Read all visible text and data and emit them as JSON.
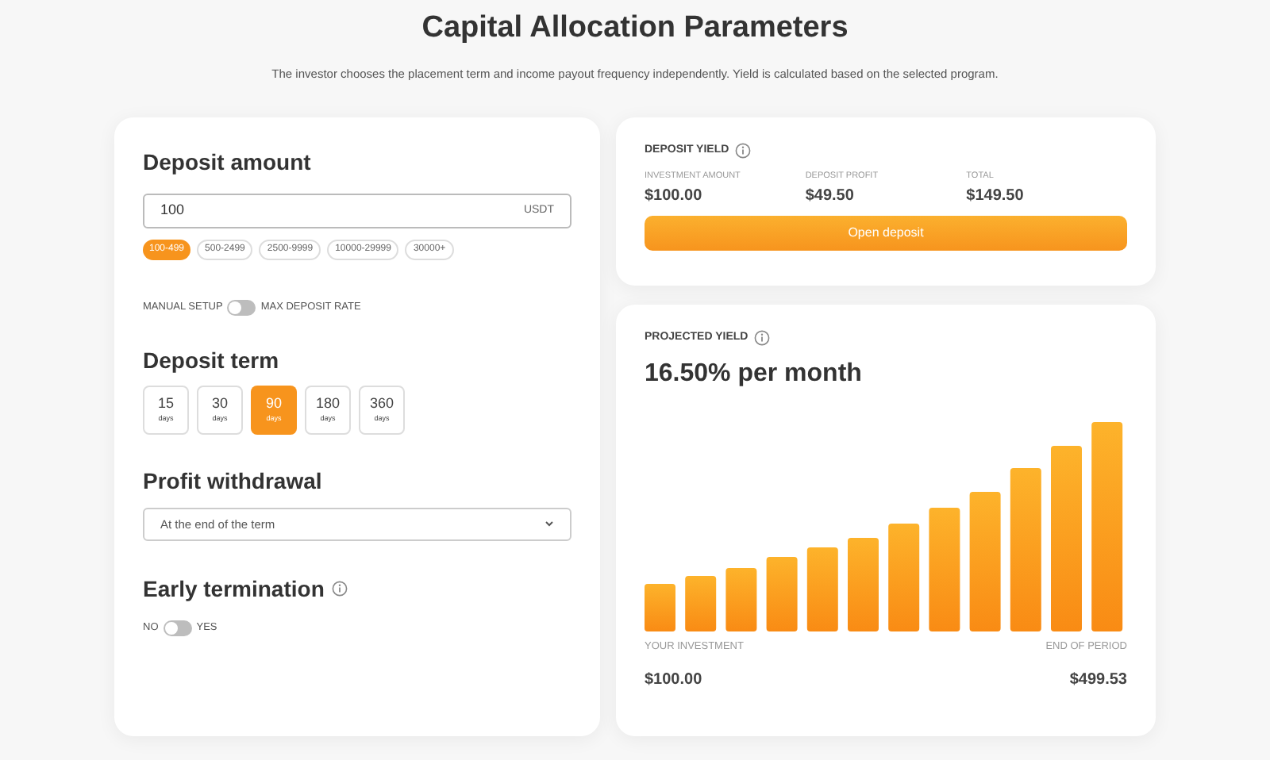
{
  "header": {
    "title": "Capital Allocation Parameters",
    "subtitle": "The investor chooses the placement term and income payout frequency independently. Yield is calculated based on the selected program."
  },
  "deposit_amount": {
    "title": "Deposit amount",
    "value": "100",
    "currency": "USDT",
    "ranges": [
      {
        "label": "100-499",
        "selected": true
      },
      {
        "label": "500-2499",
        "selected": false
      },
      {
        "label": "2500-9999",
        "selected": false
      },
      {
        "label": "10000-29999",
        "selected": false
      },
      {
        "label": "30000+",
        "selected": false
      }
    ],
    "toggle": {
      "left_label": "MANUAL SETUP",
      "right_label": "MAX DEPOSIT RATE",
      "on": false
    }
  },
  "deposit_term": {
    "title": "Deposit term",
    "options": [
      {
        "value": "15",
        "unit": "days",
        "selected": false
      },
      {
        "value": "30",
        "unit": "days",
        "selected": false
      },
      {
        "value": "90",
        "unit": "days",
        "selected": true
      },
      {
        "value": "180",
        "unit": "days",
        "selected": false
      },
      {
        "value": "360",
        "unit": "days",
        "selected": false
      }
    ]
  },
  "profit_withdrawal": {
    "title": "Profit withdrawal",
    "value": "At the end of the term"
  },
  "early_termination": {
    "title": "Early termination",
    "left_label": "NO",
    "right_label": "YES",
    "on": false
  },
  "deposit_yield": {
    "title": "DEPOSIT YIELD",
    "stats": [
      {
        "label": "INVESTMENT AMOUNT",
        "value": "$100.00"
      },
      {
        "label": "DEPOSIT PROFIT",
        "value": "$49.50"
      },
      {
        "label": "TOTAL",
        "value": "$149.50"
      }
    ],
    "button": "Open deposit"
  },
  "projected_yield": {
    "title": "PROJECTED YIELD",
    "rate": "16.50% per month",
    "start_label": "YOUR INVESTMENT",
    "start_value": "$100.00",
    "end_label": "END OF PERIOD",
    "end_value": "$499.53"
  }
}
